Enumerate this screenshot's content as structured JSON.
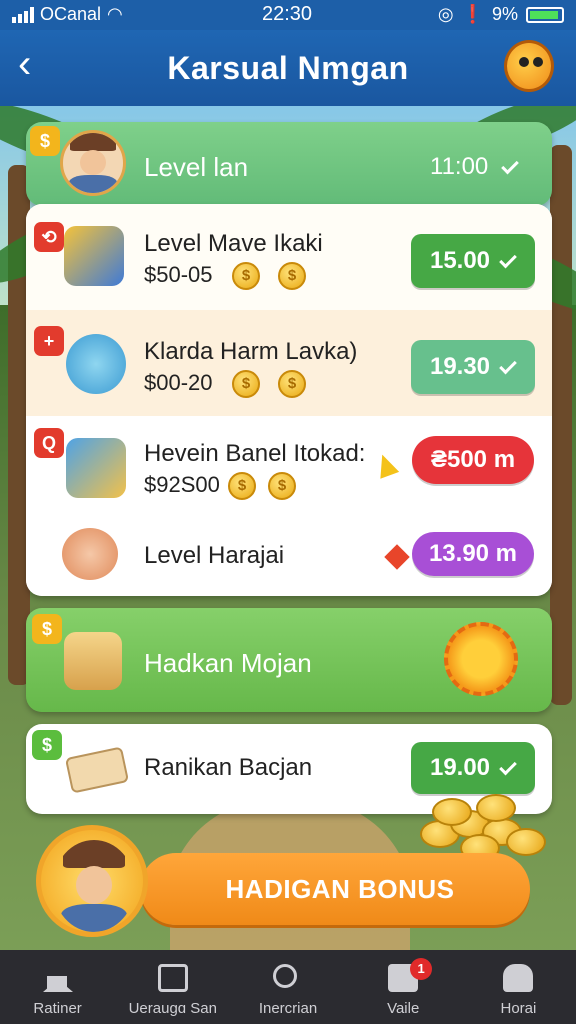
{
  "status_bar": {
    "carrier": "OCanal",
    "time": "22:30",
    "battery": "9%"
  },
  "header": {
    "title": "Karsual Nmgan"
  },
  "top_level": {
    "label": "Level lan",
    "value": "11:00"
  },
  "items": [
    {
      "title": "Level Mave Ikaki",
      "price": "$50-05",
      "button": "15.00",
      "button_color": "#46a845"
    },
    {
      "title": "Klarda Harm Lavka)",
      "price": "$00-20",
      "button": "19.30",
      "button_color": "#67c08d"
    },
    {
      "title": "Hevein Banel Itokad:",
      "price": "$92S00",
      "button": "₴500 m",
      "button_color": "#e6343a"
    },
    {
      "title": "Level Harajai",
      "price": "",
      "button": "13.90 m",
      "button_color": "#a84fd6"
    }
  ],
  "banner": {
    "title": "Hadkan Mojan"
  },
  "reward_row": {
    "title": "Ranikan Bacjan",
    "button": "19.00"
  },
  "bonus": {
    "label": "HADIGAN BONUS"
  },
  "tabs": [
    {
      "label": "Ratiner",
      "icon": "home-icon"
    },
    {
      "label": "Ueraugɑ San",
      "icon": "box-icon"
    },
    {
      "label": "Inercrian",
      "icon": "search-icon"
    },
    {
      "label": "Vaile",
      "icon": "bag-icon",
      "badge": "1"
    },
    {
      "label": "Horai",
      "icon": "people-icon"
    }
  ]
}
